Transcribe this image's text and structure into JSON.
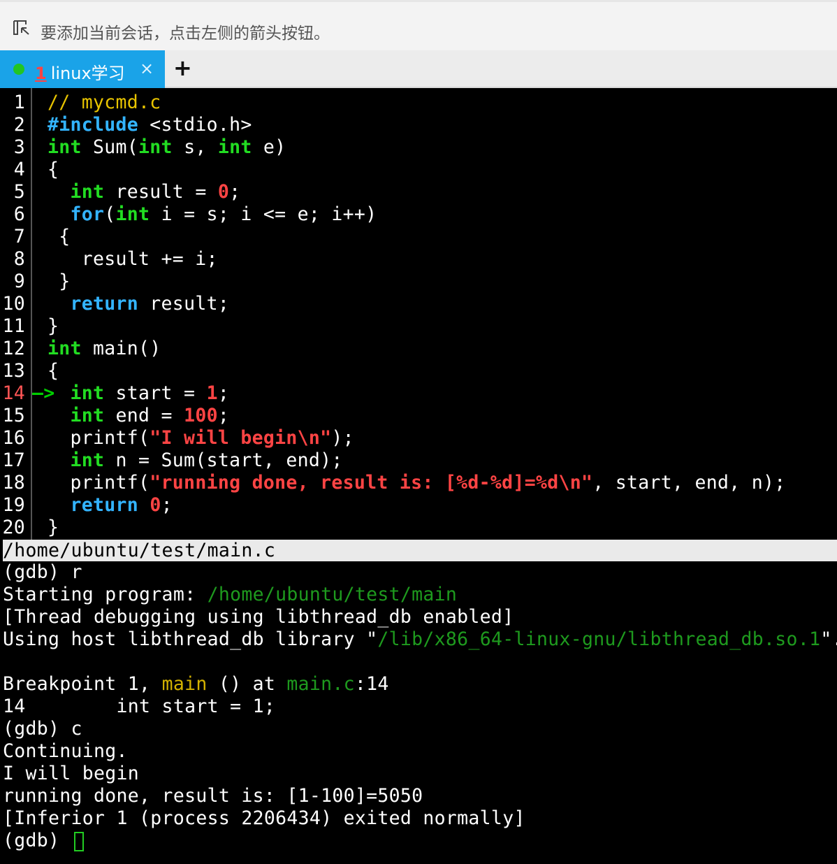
{
  "topbar": {
    "hint": "要添加当前会话，点击左侧的箭头按钮。"
  },
  "tabs": [
    {
      "number": "1",
      "title": "linux学习",
      "close": "×"
    }
  ],
  "add_tab": "+",
  "source": {
    "current_line": 14,
    "arrow": "—>",
    "lines": [
      {
        "n": "1"
      },
      {
        "n": "2"
      },
      {
        "n": "3"
      },
      {
        "n": "4"
      },
      {
        "n": "5"
      },
      {
        "n": "6"
      },
      {
        "n": "7"
      },
      {
        "n": "8"
      },
      {
        "n": "9"
      },
      {
        "n": "10"
      },
      {
        "n": "11"
      },
      {
        "n": "12"
      },
      {
        "n": "13"
      },
      {
        "n": "14"
      },
      {
        "n": "15"
      },
      {
        "n": "16"
      },
      {
        "n": "17"
      },
      {
        "n": "18"
      },
      {
        "n": "19"
      },
      {
        "n": "20"
      }
    ],
    "tokens": {
      "l1": "// mycmd.c",
      "l2a": "#include",
      "l2b": " <stdio.h>",
      "l3a": "int",
      "l3b": " Sum(",
      "l3c": "int",
      "l3d": " s, ",
      "l3e": "int",
      "l3f": " e)",
      "l4": "{",
      "l5a": "  ",
      "l5b": "int",
      "l5c": " result = ",
      "l5d": "0",
      "l5e": ";",
      "l6a": "  ",
      "l6b": "for",
      "l6c": "(",
      "l6d": "int",
      "l6e": " i = s; i <= e; i++)",
      "l7": " {",
      "l8": "   result += i;",
      "l9": " }",
      "l10a": "  ",
      "l10b": "return",
      "l10c": " result;",
      "l11": "}",
      "l12a": "int",
      "l12b": " main()",
      "l13": "{",
      "l14a": "  ",
      "l14b": "int",
      "l14c": " start = ",
      "l14d": "1",
      "l14e": ";",
      "l15a": "  ",
      "l15b": "int",
      "l15c": " end = ",
      "l15d": "100",
      "l15e": ";",
      "l16a": "  printf(",
      "l16b": "\"I will begin\\n\"",
      "l16c": ");",
      "l17a": "  ",
      "l17b": "int",
      "l17c": " n = Sum(start, end);",
      "l18a": "  printf(",
      "l18b": "\"running done, result is: [%d-%d]=%d\\n\"",
      "l18c": ", start, end, n);",
      "l19a": "  ",
      "l19b": "return",
      "l19c": " ",
      "l19d": "0",
      "l19e": ";",
      "l20": "}"
    }
  },
  "status_path": "/home/ubuntu/test/main.c",
  "gdb": {
    "o1": "(gdb) r",
    "o2a": "Starting program: ",
    "o2b": "/home/ubuntu/test/main",
    "o3": "[Thread debugging using libthread_db enabled]",
    "o4a": "Using host libthread_db library \"",
    "o4b": "/lib/x86_64-linux-gnu/libthread_db.so.1",
    "o4c": "\".",
    "o5": "",
    "o6a": "Breakpoint 1, ",
    "o6b": "main",
    "o6c": " () at ",
    "o6d": "main.c",
    "o6e": ":14",
    "o7": "14        int start = 1;",
    "o8": "(gdb) c",
    "o9": "Continuing.",
    "o10": "I will begin",
    "o11": "running done, result is: [1-100]=5050",
    "o12": "[Inferior 1 (process 2206434) exited normally]",
    "o13": "(gdb) "
  },
  "colors": {
    "tab_active": "#1aa3e8",
    "type_keyword": "#22dd22",
    "statement_keyword": "#33b4ff",
    "comment": "#e8c400",
    "constant": "#ff4444",
    "gdb_path": "#1e9a1e",
    "gdb_function": "#d4b200"
  }
}
